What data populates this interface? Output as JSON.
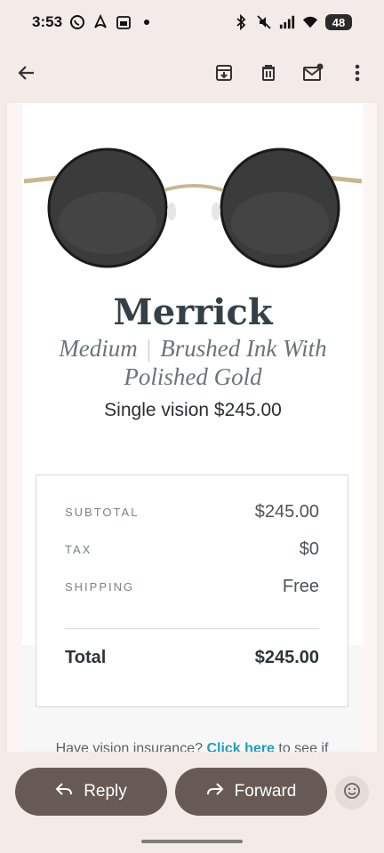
{
  "status_bar": {
    "time": "3:53",
    "battery": "48",
    "left_icons": [
      "whatsapp-icon",
      "airbnb-icon",
      "calendar-icon",
      "dot-icon"
    ],
    "right_icons": [
      "bluetooth-icon",
      "mute-icon",
      "signal-icon",
      "wifi-icon",
      "battery-icon"
    ]
  },
  "app_bar": {
    "icons": [
      "back-arrow-icon",
      "archive-icon",
      "delete-icon",
      "mark-unread-icon",
      "more-vert-icon"
    ]
  },
  "product": {
    "name": "Merrick",
    "size": "Medium",
    "separator": "|",
    "color_line1": "Brushed Ink With",
    "color_line2": "Polished Gold",
    "price_line": "Single vision $245.00"
  },
  "summary": {
    "subtotal_label": "SUBTOTAL",
    "subtotal_value": "$245.00",
    "tax_label": "TAX",
    "tax_value": "$0",
    "shipping_label": "SHIPPING",
    "shipping_value": "Free",
    "total_label": "Total",
    "total_value": "$245.00"
  },
  "insurance": {
    "text_before": "Have vision insurance? ",
    "link": "Click here",
    "text_after": " to see if"
  },
  "actions": {
    "reply_label": "Reply",
    "forward_label": "Forward"
  },
  "colors": {
    "background": "#f3ebe7",
    "pill": "#675a54",
    "link": "#1e9ec0",
    "heading": "#344048"
  }
}
